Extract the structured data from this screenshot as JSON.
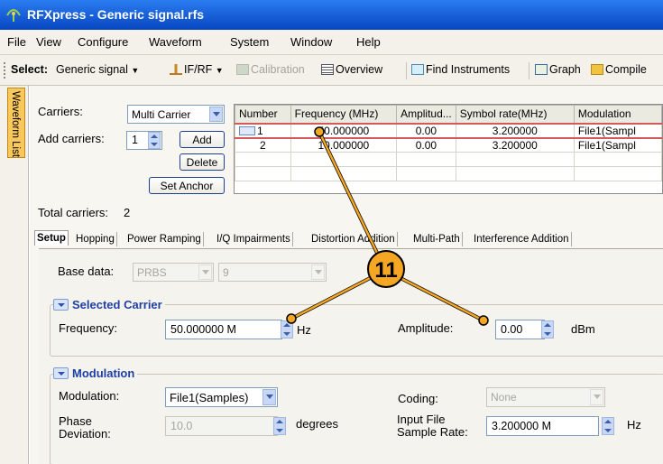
{
  "window": {
    "title": "RFXpress - Generic signal.rfs",
    "app_icon": "rfxpress-logo-icon"
  },
  "menu": [
    "File",
    "View",
    "Configure",
    "Waveform",
    "System",
    "Window",
    "Help"
  ],
  "toolbar": {
    "select_label": "Select:",
    "select_value": "Generic signal",
    "if_rf": "IF/RF",
    "calibration": "Calibration",
    "overview": "Overview",
    "find_instruments": "Find Instruments",
    "graph": "Graph",
    "compile": "Compile"
  },
  "side_tab": {
    "label": "Waveform List"
  },
  "carriers": {
    "label": "Carriers:",
    "mode": "Multi Carrier",
    "add_label": "Add carriers:",
    "add_count": "1",
    "add_button": "Add",
    "delete_button": "Delete",
    "set_anchor_button": "Set Anchor",
    "total_label": "Total carriers:",
    "total_value": "2"
  },
  "table": {
    "columns": [
      "Number",
      "Frequency (MHz)",
      "Amplitud...",
      "Symbol rate(MHz)",
      "Modulation"
    ],
    "rows": [
      [
        "1",
        "50.000000",
        "0.00",
        "3.200000",
        "File1(Sampl"
      ],
      [
        "2",
        "10.000000",
        "0.00",
        "3.200000",
        "File1(Sampl"
      ]
    ]
  },
  "tabs": [
    "Setup",
    "Hopping",
    "Power Ramping",
    "I/Q Impairments",
    "Distortion Addition",
    "Multi-Path",
    "Interference Addition"
  ],
  "setup": {
    "base_data_label": "Base data:",
    "base_data_value": "PRBS",
    "base_data_order": "9",
    "selected_carrier_title": "Selected Carrier",
    "frequency_label": "Frequency:",
    "frequency_value": "50.000000 M",
    "frequency_unit": "Hz",
    "amplitude_label": "Amplitude:",
    "amplitude_value": "0.00",
    "amplitude_unit": "dBm",
    "modulation_title": "Modulation",
    "modulation_label": "Modulation:",
    "modulation_value": "File1(Samples)",
    "coding_label": "Coding:",
    "coding_value": "None",
    "phase_dev_label_1": "Phase",
    "phase_dev_label_2": "Deviation:",
    "phase_dev_value": "10.0",
    "phase_dev_unit": "degrees",
    "input_rate_label_1": "Input File",
    "input_rate_label_2": "Sample Rate:",
    "input_rate_value": "3.200000 M",
    "input_rate_unit": "Hz"
  },
  "callout": {
    "number": "11",
    "color": "#f5a623"
  }
}
